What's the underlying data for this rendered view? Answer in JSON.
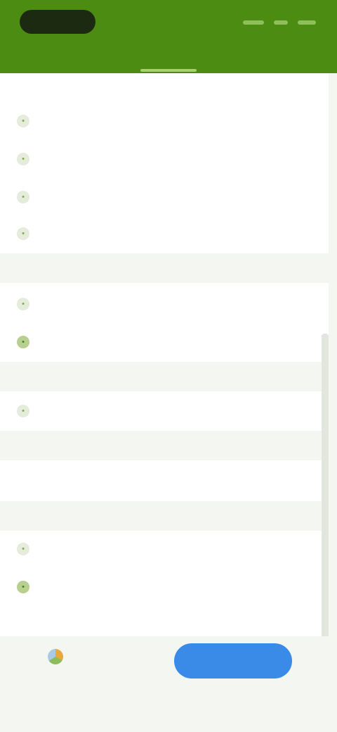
{
  "appbar": {
    "logo_icon": "app-logo",
    "tabs": [
      {
        "label": "",
        "active": false
      },
      {
        "label": "",
        "active": true
      },
      {
        "label": "",
        "active": false
      }
    ]
  },
  "panel": {
    "section_label": "",
    "items": [
      {
        "icon": "item-icon",
        "label": "",
        "value": ""
      },
      {
        "icon": "item-icon",
        "label": "",
        "value": ""
      },
      {
        "icon": "item-icon",
        "label": "",
        "value": ""
      },
      {
        "icon": "item-icon",
        "label": "",
        "value": ""
      }
    ],
    "items2": [
      {
        "icon": "item-icon",
        "label": "",
        "value": ""
      },
      {
        "icon": "item-icon",
        "label": "",
        "value": ""
      }
    ],
    "items3": [
      {
        "icon": "item-icon",
        "label": "",
        "value": ""
      }
    ],
    "items4": [
      {
        "icon": "",
        "label": "",
        "value": ""
      }
    ],
    "items5": [
      {
        "icon": "item-icon",
        "label": "",
        "value": ""
      },
      {
        "icon": "item-icon",
        "label": "",
        "value": ""
      }
    ]
  },
  "bottom": {
    "secondary_label": "",
    "primary_label": "",
    "footer_note": ""
  },
  "colors": {
    "appbar": "#4d8c12",
    "primary": "#3a8be8",
    "background": "#f4f6f2"
  }
}
